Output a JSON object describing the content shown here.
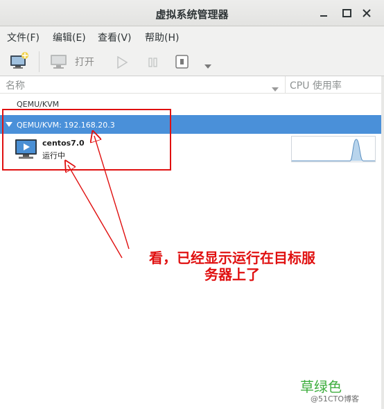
{
  "window": {
    "title": "虚拟系统管理器"
  },
  "menu": {
    "items": [
      "文件(F)",
      "编辑(E)",
      "查看(V)",
      "帮助(H)"
    ]
  },
  "toolbar": {
    "new_vm_icon": "new-vm-icon",
    "open_icon": "monitor-icon",
    "open_label": "打开",
    "run_icon": "play-icon",
    "pause_icon": "pause-icon",
    "shutdown_icon": "power-stop-icon",
    "shutdown_menu_icon": "chevron-down-icon"
  },
  "list": {
    "columns": {
      "name": "名称",
      "cpu": "CPU 使用率"
    },
    "connections": [
      {
        "label": "QEMU/KVM",
        "selected": false
      },
      {
        "label": "QEMU/KVM: 192.168.20.3",
        "selected": true
      }
    ],
    "vm": {
      "name": "centos7.0",
      "status": "运行中"
    }
  },
  "annotation": {
    "text_line1": "看，已经显示运行在目标服",
    "text_line2": "务器上了"
  },
  "watermark": {
    "green_text": "草绿色",
    "site": "@51CTO博客"
  },
  "colors": {
    "selection": "#4a90d9",
    "annotation": "#e01010",
    "watermark_green": "#3fae3f"
  }
}
